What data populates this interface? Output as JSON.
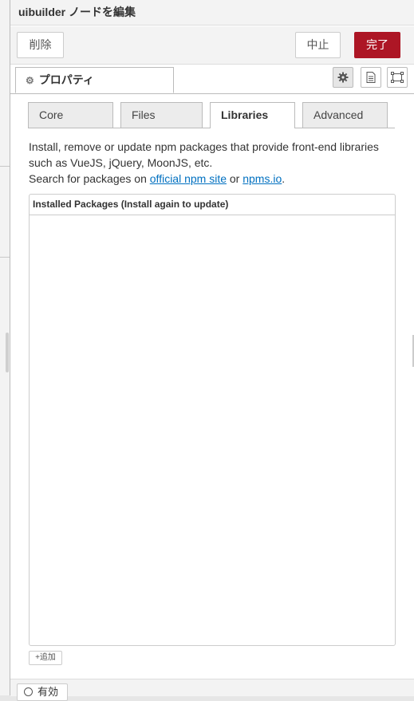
{
  "tray": {
    "title": "uibuilder ノードを編集",
    "delete_label": "削除",
    "cancel_label": "中止",
    "done_label": "完了"
  },
  "properties_tab": {
    "label": "プロパティ"
  },
  "tabs": [
    {
      "label": "Core",
      "active": false
    },
    {
      "label": "Files",
      "active": false
    },
    {
      "label": "Libraries",
      "active": true
    },
    {
      "label": "Advanced",
      "active": false
    }
  ],
  "libraries": {
    "desc_line1": "Install, remove or update npm packages that provide front-end libraries",
    "desc_line2": "such as VueJS, jQuery, MoonJS, etc.",
    "desc_line3_prefix": "Search for packages on ",
    "link_npm": "official npm site",
    "desc_or": " or ",
    "link_npms": "npms.io",
    "desc_end": ".",
    "packages_header": "Installed Packages (Install again to update)",
    "packages": [],
    "add_label": "追加"
  },
  "footer": {
    "enabled_label": "有効"
  },
  "colors": {
    "done_button": "#ad1625",
    "link": "#0070c0"
  }
}
